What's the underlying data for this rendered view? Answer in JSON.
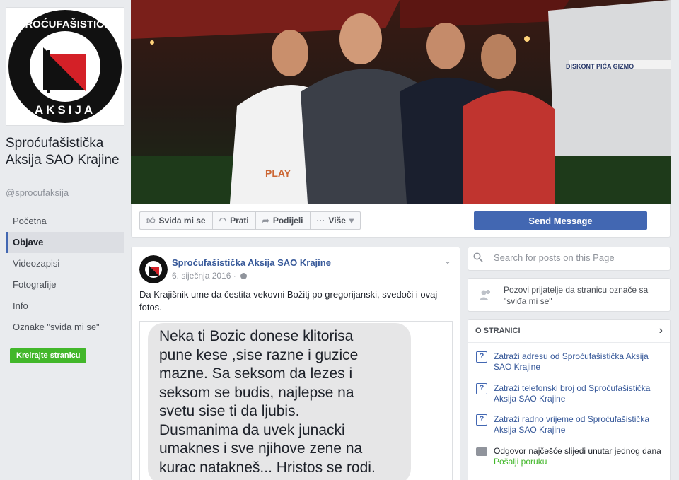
{
  "page": {
    "name": "Sproćufašistička Aksija SAO Krajine",
    "handle": "@sprocufaksija",
    "logo_text": "Sproćufašistička Aksija"
  },
  "nav": {
    "items": [
      {
        "label": "Početna"
      },
      {
        "label": "Objave",
        "active": true
      },
      {
        "label": "Videozapisi"
      },
      {
        "label": "Fotografije"
      },
      {
        "label": "Info"
      },
      {
        "label": "Oznake \"sviđa mi se\""
      }
    ],
    "create_page": "Kreirajte stranicu"
  },
  "cover": {
    "van_text": "DISKONT PIĆA GIZMO",
    "shirt_text": "PLAY"
  },
  "actions": {
    "like": "Sviđa mi se",
    "follow": "Prati",
    "share": "Podijeli",
    "more": "Više",
    "send_message": "Send Message"
  },
  "post": {
    "author": "Sproćufašistička Aksija SAO Krajine",
    "date": "6. siječnja 2016 ·",
    "text": "Da Krajišnik ume da čestita vekovni Božitj po gregorijanski, svedoči i ovaj fotos.",
    "image_message": "Neka ti Bozic donese klitorisa\npune kese ,sise razne i guzice\nmazne. Sa seksom da lezes i\nseksom se budis, najlepse na\nsvetu sise ti da ljubis.\nDusmanima da uvek junacki\numaknes i sve njihove zene na\nkurac natakneš... Hristos se rodi."
  },
  "sidebar": {
    "search_placeholder": "Search for posts on this Page",
    "invite_text": "Pozovi prijatelje da stranicu označe sa \"sviđa mi se\"",
    "about_title": "O STRANICI",
    "about_items": [
      {
        "text": "Zatraži adresu od Sproćufašistička Aksija SAO Krajine"
      },
      {
        "text": "Zatraži telefonski broj od Sproćufašistička Aksija SAO Krajine"
      },
      {
        "text": "Zatraži radno vrijeme od Sproćufašistička Aksija SAO Krajine"
      }
    ],
    "response_text": "Odgovor najčešće slijedi unutar jednog dana",
    "send_link": "Pošalji poruku"
  },
  "colors": {
    "fb_blue": "#4267b2",
    "link": "#365899",
    "green": "#42b72a",
    "logo_red": "#d42027"
  }
}
